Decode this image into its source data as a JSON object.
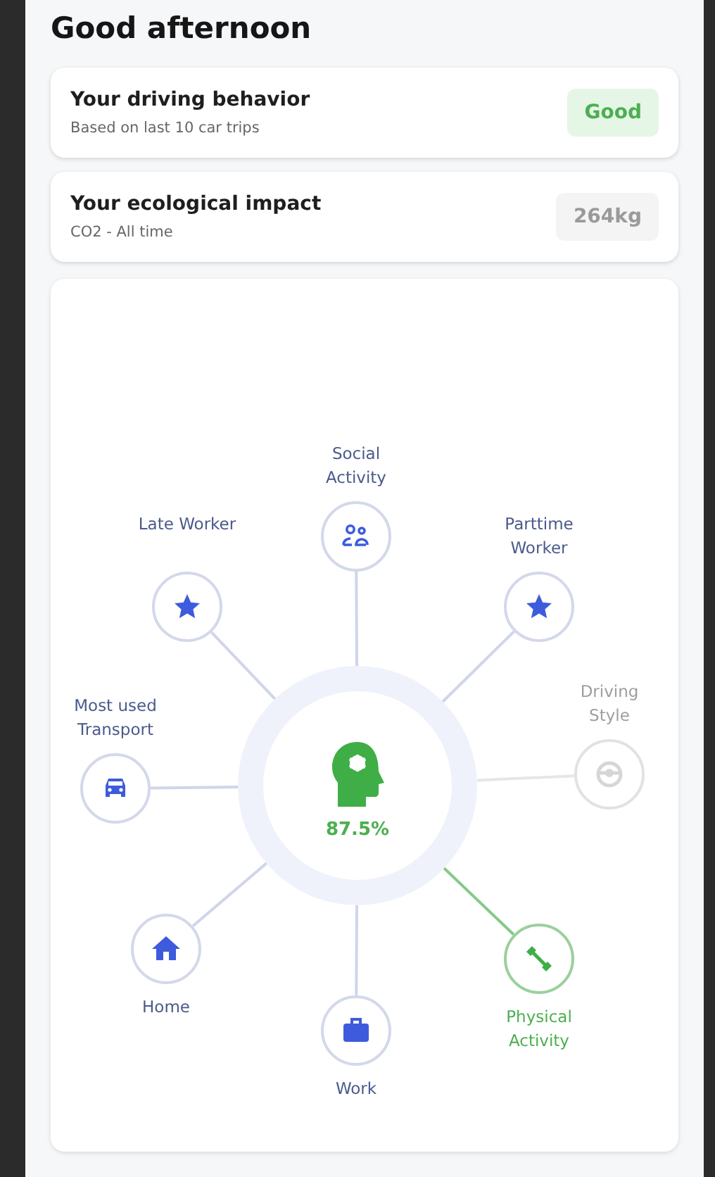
{
  "greeting": "Good afternoon",
  "summary_cards": [
    {
      "title": "Your driving behavior",
      "subtitle": "Based on last 10 car trips",
      "badge": "Good",
      "highlighted": true
    },
    {
      "title": "Your ecological impact",
      "subtitle": "CO2 - All time",
      "badge": "264kg",
      "highlighted": false
    }
  ],
  "profile_chart": {
    "score": "87.5%",
    "nodes": [
      {
        "label": "Social Activity",
        "disabled": false,
        "achieved": false
      },
      {
        "label": "Late Worker",
        "disabled": false,
        "achieved": false
      },
      {
        "label": "Parttime Worker",
        "disabled": false,
        "achieved": false
      },
      {
        "label": "Most used Transport",
        "disabled": false,
        "achieved": false
      },
      {
        "label": "Driving Style",
        "disabled": true,
        "achieved": false
      },
      {
        "label": "Home",
        "disabled": false,
        "achieved": false
      },
      {
        "label": "Work",
        "disabled": false,
        "achieved": false
      },
      {
        "label": "Physical Activity",
        "disabled": false,
        "achieved": true
      }
    ]
  }
}
